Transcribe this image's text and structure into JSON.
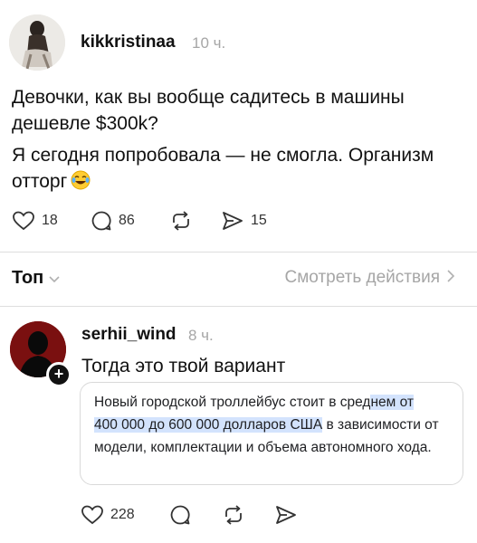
{
  "post": {
    "username": "kikkristinaa",
    "time": "10 ч.",
    "lines": [
      "Девочки, как вы вообще садитесь в машины",
      "дешевле $300k?",
      "Я сегодня попробовала — не смогла. Организм",
      "отторг"
    ],
    "emoji": "laughing-tears",
    "likes": "18",
    "comments": "86",
    "shares": "15"
  },
  "sort_bar": {
    "sort_label": "Топ",
    "activity_label": "Смотреть действия"
  },
  "reply": {
    "username": "serhii_wind",
    "time": "8 ч.",
    "text": "Тогда это твой вариант",
    "quote": {
      "part1": "Новый городской троллейбус стоит в сред",
      "part2_highlight": "нем от",
      "part3_highlight": "400 000 до 600 000 долларов США",
      "part4": " в зависимости от модели, комплектации и объема автономного хода."
    },
    "likes": "228"
  },
  "colors": {
    "highlight": "#d3e3fd",
    "muted": "#a6a6a6",
    "reply_avatar_bg": "#7a1010"
  }
}
